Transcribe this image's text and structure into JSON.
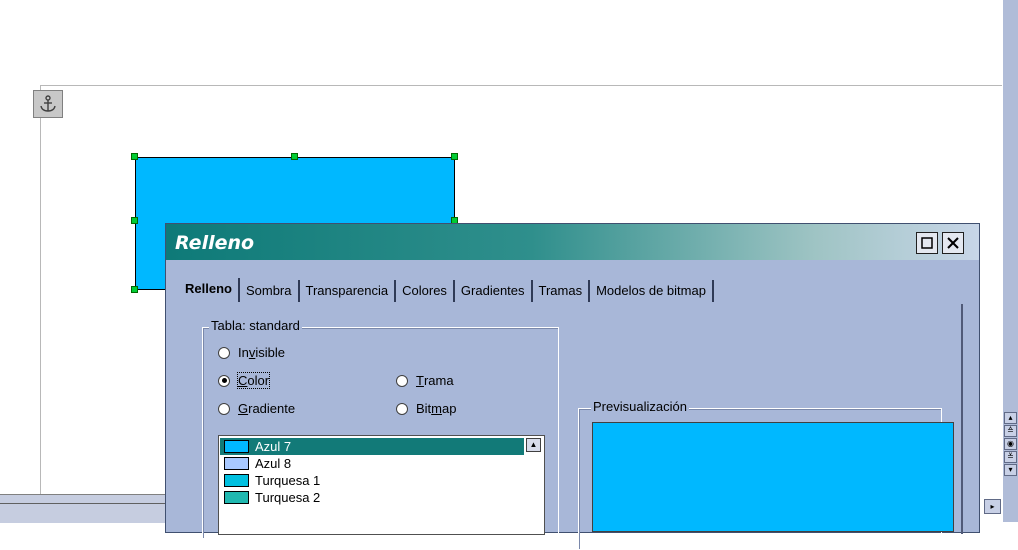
{
  "document": {
    "anchor_icon": "anchor-icon",
    "shape_fill_color": "#00b8ff"
  },
  "dialog": {
    "title": "Relleno",
    "title_bar_color": "#0e7a78",
    "tabs": [
      {
        "label": "Relleno",
        "active": true
      },
      {
        "label": "Sombra",
        "active": false
      },
      {
        "label": "Transparencia",
        "active": false
      },
      {
        "label": "Colores",
        "active": false
      },
      {
        "label": "Gradientes",
        "active": false
      },
      {
        "label": "Tramas",
        "active": false
      },
      {
        "label": "Modelos de bitmap",
        "active": false
      }
    ],
    "group_label": "Tabla: standard",
    "radios": {
      "invisible": {
        "pre": "In",
        "accel": "v",
        "post": "isible",
        "checked": false
      },
      "color": {
        "pre": "",
        "accel": "C",
        "post": "olor",
        "checked": true
      },
      "trama": {
        "pre": "",
        "accel": "T",
        "post": "rama",
        "checked": false
      },
      "gradiente": {
        "pre": "",
        "accel": "G",
        "post": "radiente",
        "checked": false
      },
      "bitmap": {
        "pre": "Bit",
        "accel": "m",
        "post": "ap",
        "checked": false
      }
    },
    "color_list": [
      {
        "name": "Azul 7",
        "color": "#00b8ff",
        "selected": true
      },
      {
        "name": "Azul 8",
        "color": "#a8c8ff",
        "selected": false
      },
      {
        "name": "Turquesa 1",
        "color": "#00c0e0",
        "selected": false
      },
      {
        "name": "Turquesa 2",
        "color": "#20b8b0",
        "selected": false
      }
    ],
    "preview_label": "Previsualización",
    "preview_color": "#00b8ff"
  }
}
